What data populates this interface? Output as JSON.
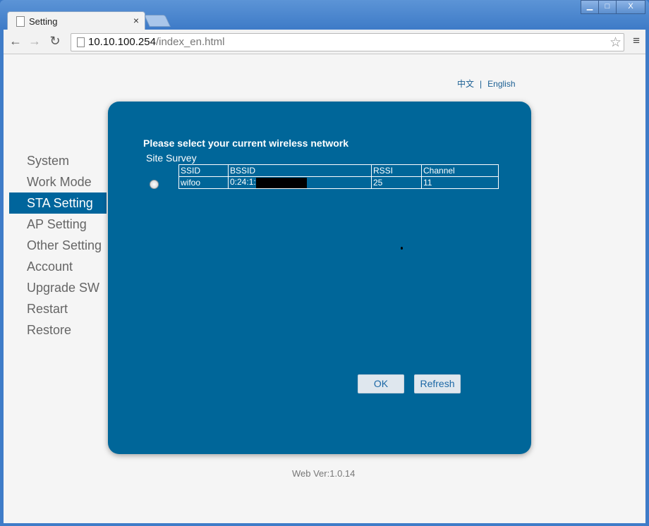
{
  "browser": {
    "tab_title": "Setting",
    "tab_close": "×",
    "url_host": "10.10.100.254",
    "url_path": "/index_en.html",
    "controls": {
      "minimize": "▁",
      "maximize": "□",
      "close": "X"
    }
  },
  "lang": {
    "chinese": "中文",
    "separator": "|",
    "english": "English"
  },
  "sidebar": {
    "items": [
      {
        "label": "System"
      },
      {
        "label": "Work Mode"
      },
      {
        "label": "STA Setting"
      },
      {
        "label": "AP Setting"
      },
      {
        "label": "Other Setting"
      },
      {
        "label": "Account"
      },
      {
        "label": "Upgrade SW"
      },
      {
        "label": "Restart"
      },
      {
        "label": "Restore"
      }
    ]
  },
  "panel": {
    "heading": "Please select your current wireless network",
    "survey_label": "Site Survey",
    "table": {
      "headers": [
        "SSID",
        "BSSID",
        "RSSI",
        "Channel"
      ],
      "rows": [
        {
          "ssid": "wifoo",
          "bssid": "0:24:1:",
          "rssi": "25",
          "channel": "11"
        }
      ]
    },
    "ok_label": "OK",
    "refresh_label": "Refresh"
  },
  "footer": {
    "version": "Web Ver:1.0.14"
  },
  "colors": {
    "panel": "#006699",
    "active": "#00659c"
  }
}
